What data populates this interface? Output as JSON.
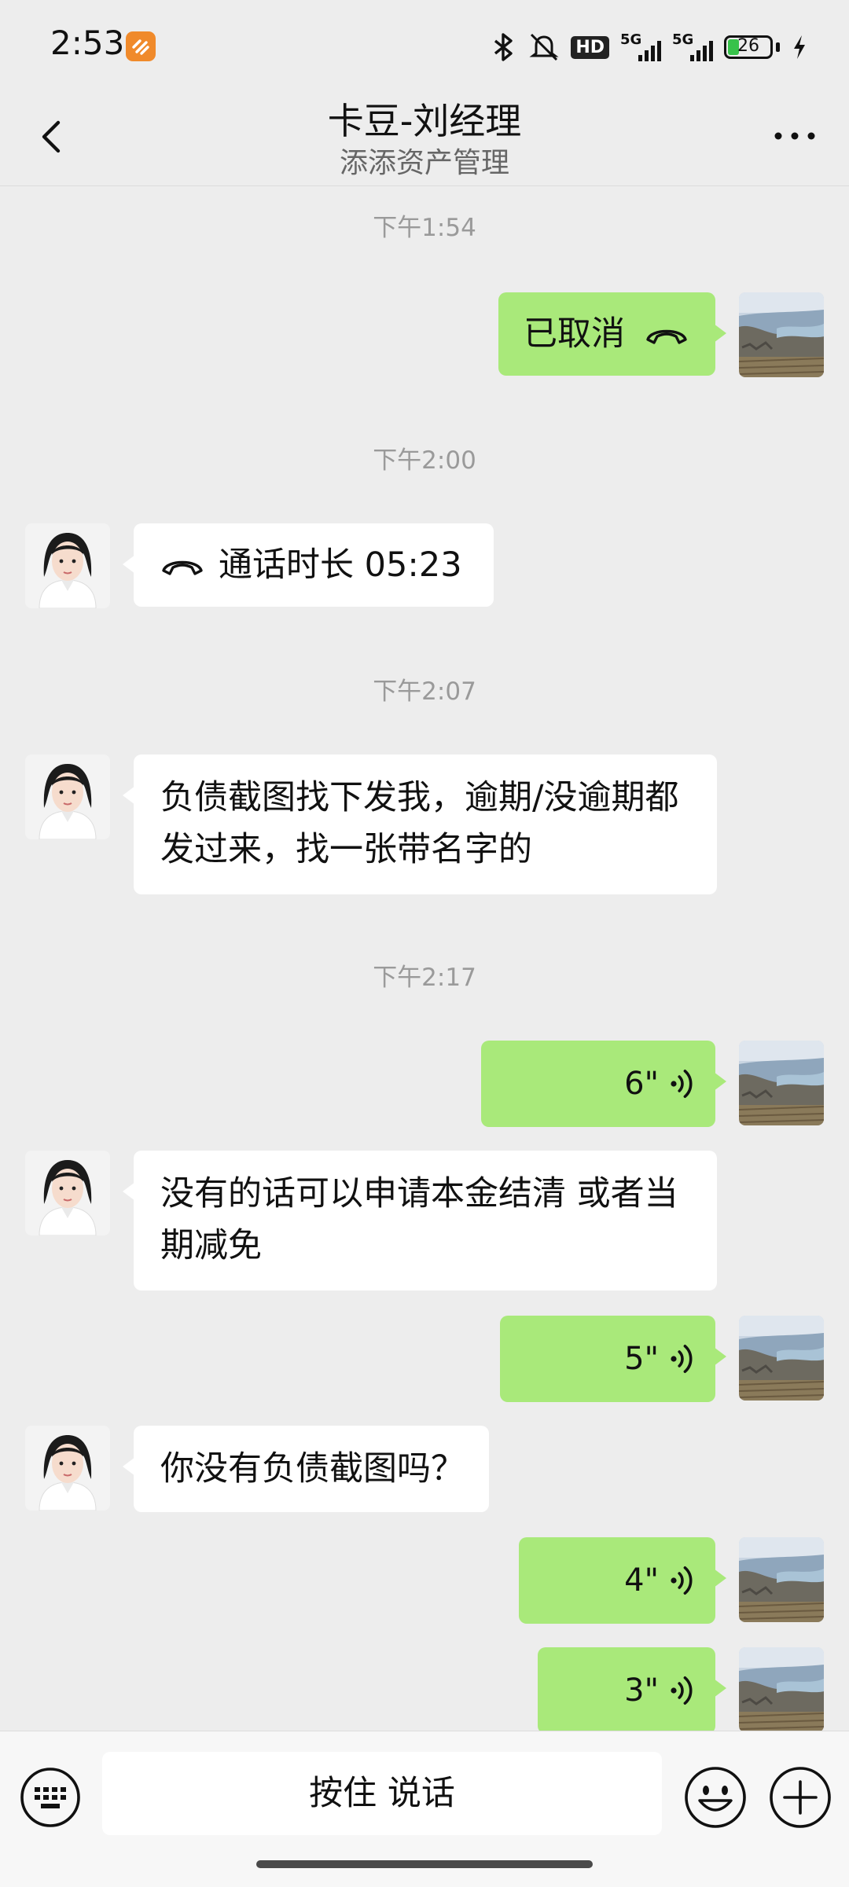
{
  "status": {
    "time": "2:53",
    "network_1": "5G",
    "network_2": "5G",
    "hd": "HD",
    "battery": "26"
  },
  "header": {
    "title": "卡豆-刘经理",
    "subtitle": "添添资产管理"
  },
  "messages": [
    {
      "time": "下午1:54"
    },
    {
      "text": "已取消"
    },
    {
      "time": "下午2:00"
    },
    {
      "text": "通话时长 05:23"
    },
    {
      "time": "下午2:07"
    },
    {
      "text": "负债截图找下发我，逾期/没逾期都发过来，找一张带名字的"
    },
    {
      "time": "下午2:17"
    },
    {
      "duration": "6\""
    },
    {
      "text": "没有的话可以申请本金结清 或者当期减免"
    },
    {
      "duration": "5\""
    },
    {
      "text": "你没有负债截图吗？"
    },
    {
      "duration": "4\""
    },
    {
      "duration": "3\""
    }
  ],
  "input": {
    "talk_label": "按住 说话"
  }
}
